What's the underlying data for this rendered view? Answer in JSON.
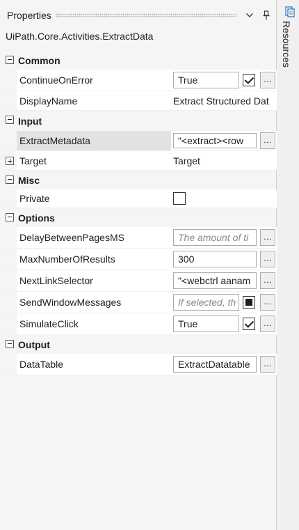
{
  "panel": {
    "title": "Properties",
    "activity": "UiPath.Core.Activities.ExtractData"
  },
  "side_tab": {
    "label": "Resources"
  },
  "categories": {
    "common": "Common",
    "input": "Input",
    "misc": "Misc",
    "options": "Options",
    "output": "Output"
  },
  "props": {
    "continue_on_error": {
      "name": "ContinueOnError",
      "value": "True",
      "checked": true
    },
    "display_name": {
      "name": "DisplayName",
      "value": "Extract Structured Dat"
    },
    "extract_metadata": {
      "name": "ExtractMetadata",
      "value": "\"<extract><row"
    },
    "target": {
      "name": "Target",
      "value": "Target"
    },
    "private": {
      "name": "Private",
      "checked": false
    },
    "delay_between_pages": {
      "name": "DelayBetweenPagesMS",
      "placeholder": "The amount of ti"
    },
    "max_number_of_results": {
      "name": "MaxNumberOfResults",
      "value": "300"
    },
    "next_link_selector": {
      "name": "NextLinkSelector",
      "value": "\"<webctrl aanam"
    },
    "send_window_messages": {
      "name": "SendWindowMessages",
      "placeholder": "If selected, th"
    },
    "simulate_click": {
      "name": "SimulateClick",
      "value": "True",
      "checked": true
    },
    "data_table": {
      "name": "DataTable",
      "value": "ExtractDatatable"
    }
  },
  "ellipsis": "..."
}
